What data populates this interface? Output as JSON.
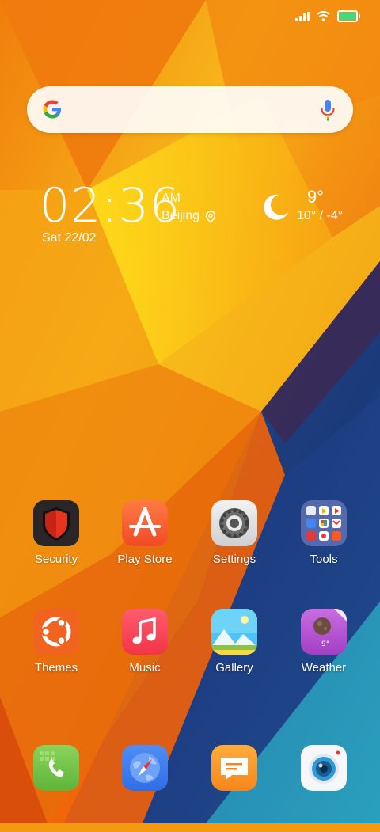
{
  "clock": {
    "time": "02:36",
    "ampm": "AM",
    "city": "Beijing",
    "date": "Sat 22/02"
  },
  "weather": {
    "icon": "moon-icon",
    "current_temp": "9°",
    "range": "10° / -4°"
  },
  "search": {
    "icon": "google-logo",
    "mic_icon": "microphone-icon"
  },
  "status_bar": {
    "icons": [
      "signal-icon",
      "wifi-icon",
      "battery-icon"
    ],
    "battery_color": "#3ddc84"
  },
  "apps": {
    "row1": [
      {
        "label": "Security",
        "icon": "shield-icon"
      },
      {
        "label": "Play Store",
        "icon": "app-store-icon"
      },
      {
        "label": "Settings",
        "icon": "gear-icon"
      },
      {
        "label": "Tools",
        "icon": "folder-icon"
      }
    ],
    "row2": [
      {
        "label": "Themes",
        "icon": "themes-icon"
      },
      {
        "label": "Music",
        "icon": "music-note-icon"
      },
      {
        "label": "Gallery",
        "icon": "gallery-icon"
      },
      {
        "label": "Weather",
        "icon": "weather-icon"
      }
    ]
  },
  "dock": [
    {
      "icon": "phone-icon"
    },
    {
      "icon": "browser-compass-icon"
    },
    {
      "icon": "messages-icon"
    },
    {
      "icon": "camera-icon"
    }
  ]
}
